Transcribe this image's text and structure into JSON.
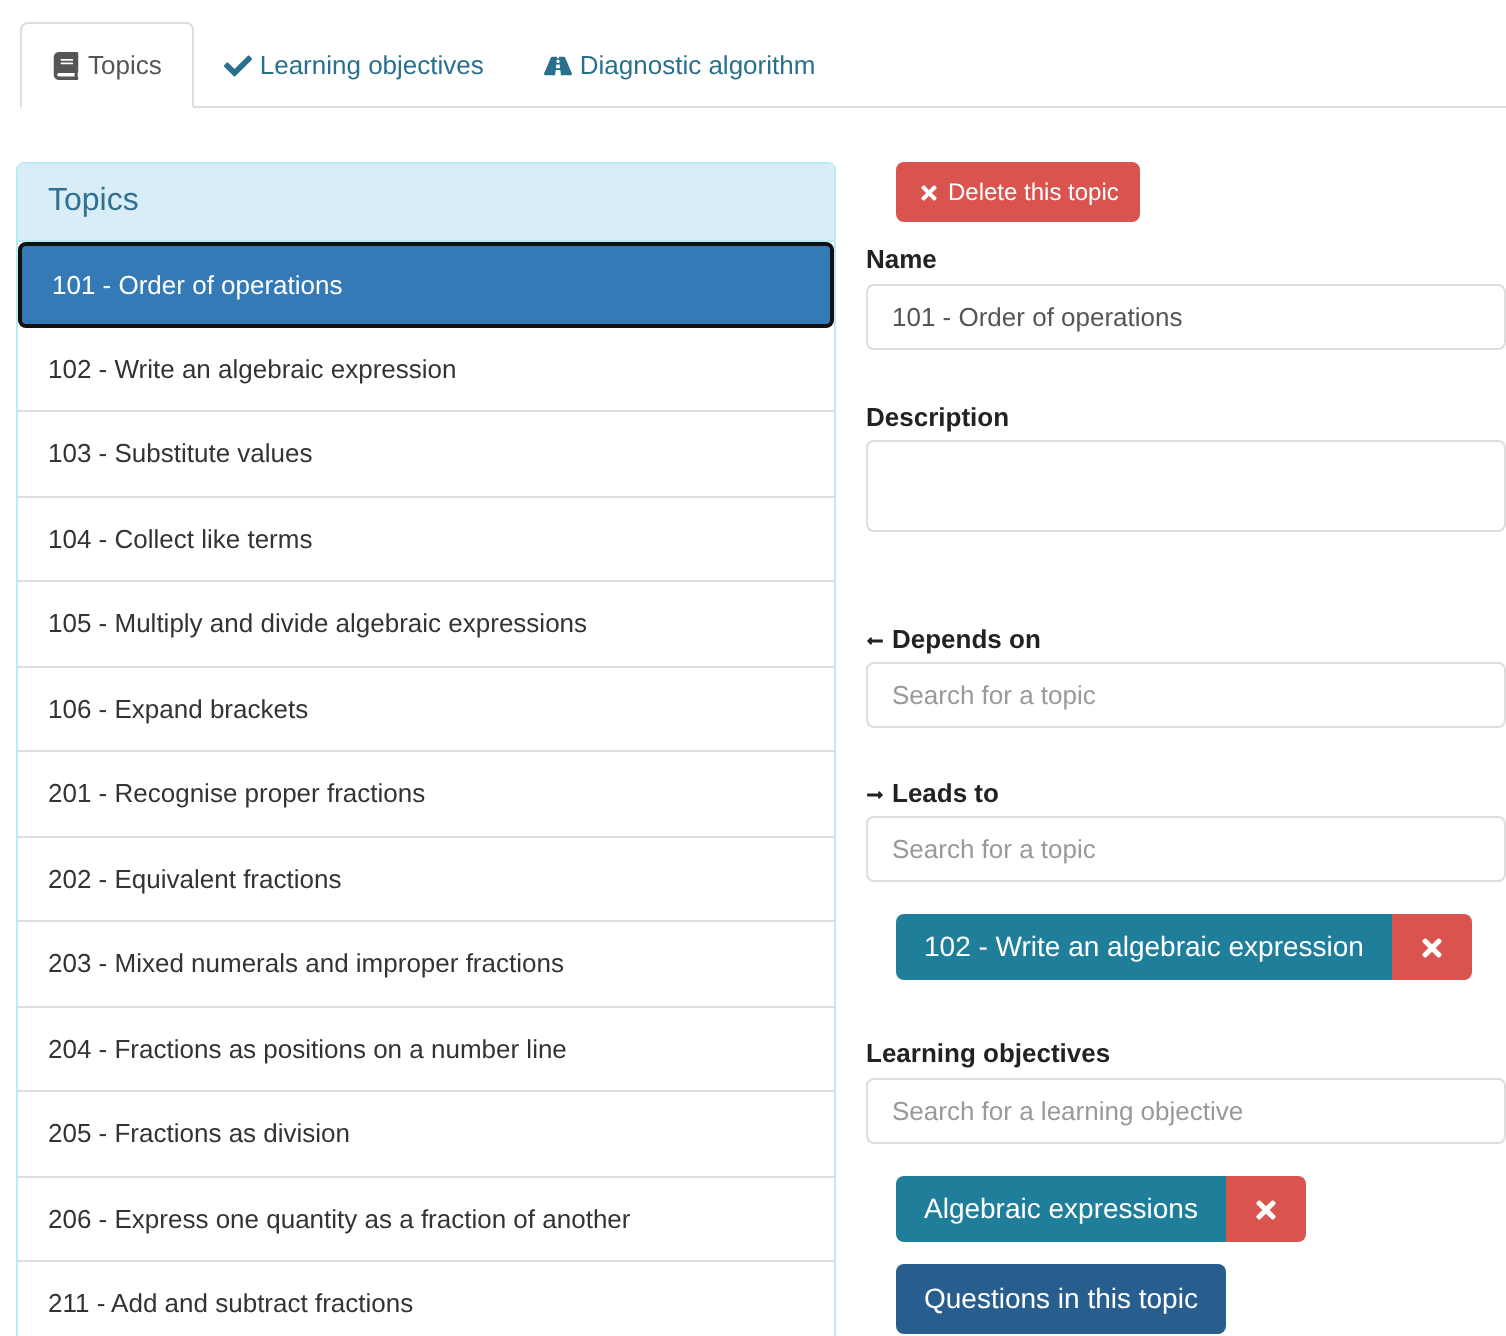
{
  "tabs": [
    {
      "label": "Topics",
      "selected": true
    },
    {
      "label": "Learning objectives",
      "selected": false
    },
    {
      "label": "Diagnostic algorithm",
      "selected": false
    }
  ],
  "topics_panel": {
    "title": "Topics",
    "items": [
      {
        "label": "101 - Order of operations",
        "selected": true
      },
      {
        "label": "102 - Write an algebraic expression",
        "selected": false
      },
      {
        "label": "103 - Substitute values",
        "selected": false
      },
      {
        "label": "104 - Collect like terms",
        "selected": false
      },
      {
        "label": "105 - Multiply and divide algebraic expressions",
        "selected": false
      },
      {
        "label": "106 - Expand brackets",
        "selected": false
      },
      {
        "label": "201 - Recognise proper fractions",
        "selected": false
      },
      {
        "label": "202 - Equivalent fractions",
        "selected": false
      },
      {
        "label": "203 - Mixed numerals and improper fractions",
        "selected": false
      },
      {
        "label": "204 - Fractions as positions on a number line",
        "selected": false
      },
      {
        "label": "205 - Fractions as division",
        "selected": false
      },
      {
        "label": "206 - Express one quantity as a fraction of another",
        "selected": false
      },
      {
        "label": "211 - Add and subtract fractions",
        "selected": false
      }
    ]
  },
  "editor": {
    "delete_button": "Delete this topic",
    "name": {
      "label": "Name",
      "value": "101 - Order of operations"
    },
    "description": {
      "label": "Description"
    },
    "depends_on": {
      "label": "Depends on",
      "placeholder": "Search for a topic"
    },
    "leads_to": {
      "label": "Leads to",
      "placeholder": "Search for a topic",
      "tags": [
        "102 - Write an algebraic expression"
      ]
    },
    "learning_objectives": {
      "label": "Learning objectives",
      "placeholder": "Search for a learning objective",
      "tags": [
        "Algebraic expressions"
      ]
    },
    "questions_button": "Questions in this topic"
  }
}
